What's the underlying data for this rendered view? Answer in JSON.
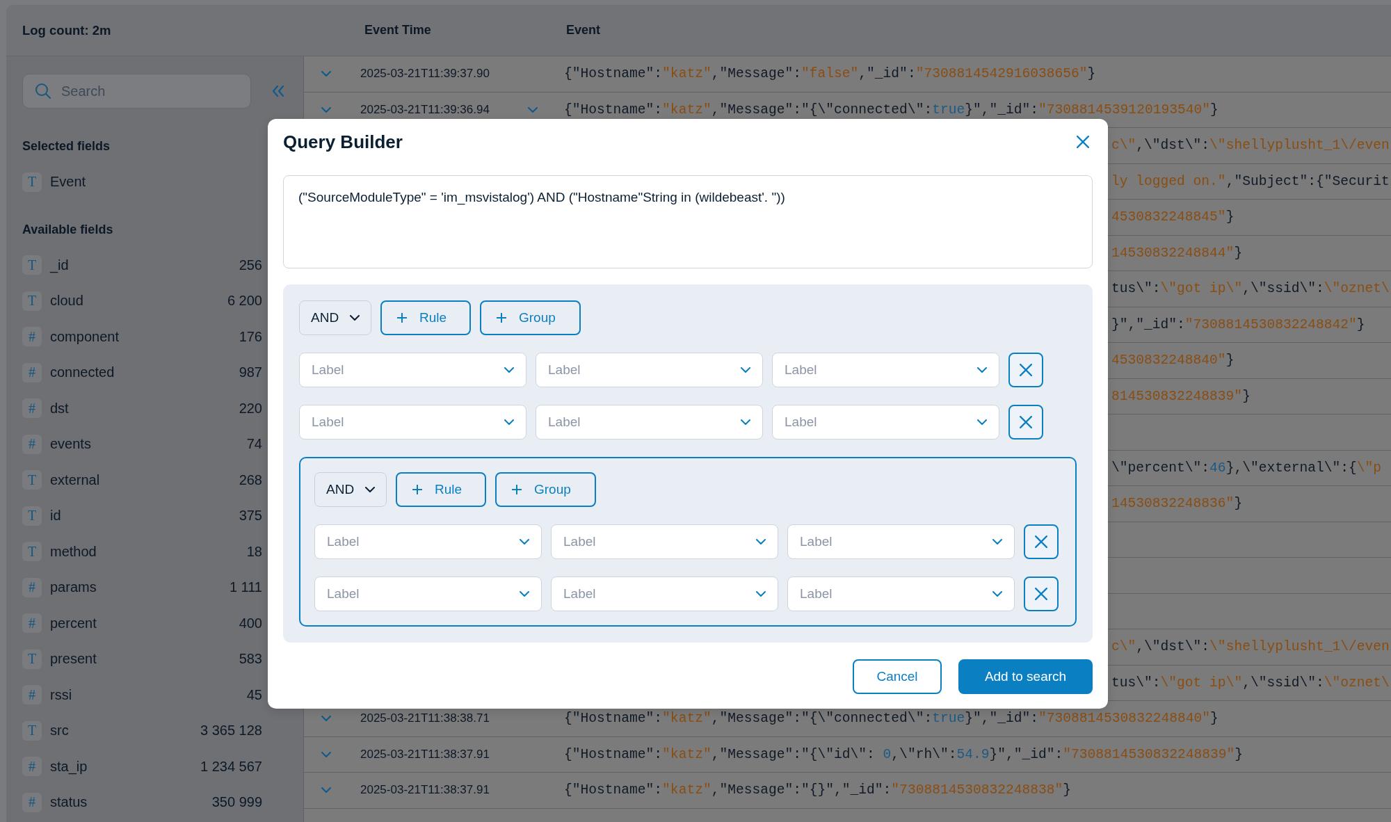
{
  "header": {
    "log_count": "Log count: 2m"
  },
  "sidebar": {
    "search": {
      "placeholder": "Search"
    },
    "selected_title": "Selected fields",
    "selected_fields": [
      {
        "type": "T",
        "name": "Event"
      }
    ],
    "available_title": "Available fields",
    "available_fields": [
      {
        "type": "T",
        "name": "_id",
        "count": "256"
      },
      {
        "type": "T",
        "name": "cloud",
        "count": "6 200"
      },
      {
        "type": "#",
        "name": "component",
        "count": "176"
      },
      {
        "type": "#",
        "name": "connected",
        "count": "987"
      },
      {
        "type": "#",
        "name": "dst",
        "count": "220"
      },
      {
        "type": "#",
        "name": "events",
        "count": "74"
      },
      {
        "type": "T",
        "name": "external",
        "count": "268"
      },
      {
        "type": "T",
        "name": "id",
        "count": "375"
      },
      {
        "type": "T",
        "name": "method",
        "count": "18"
      },
      {
        "type": "#",
        "name": "params",
        "count": "1 111"
      },
      {
        "type": "#",
        "name": "percent",
        "count": "400"
      },
      {
        "type": "T",
        "name": "present",
        "count": "583"
      },
      {
        "type": "#",
        "name": "rssi",
        "count": "45"
      },
      {
        "type": "T",
        "name": "src",
        "count": "3 365 128"
      },
      {
        "type": "#",
        "name": "sta_ip",
        "count": "1 234 567"
      },
      {
        "type": "#",
        "name": "status",
        "count": "350 999"
      }
    ]
  },
  "log_table": {
    "columns": [
      "Event Time",
      "Event"
    ],
    "rows": [
      {
        "time": "2025-03-21T11:39:37.90",
        "hovered": false,
        "event": [
          {
            "kind": "plain",
            "text": "{\"Hostname\":"
          },
          {
            "kind": "string",
            "text": "\"katz\""
          },
          {
            "kind": "plain",
            "text": ",\"Message\":"
          },
          {
            "kind": "string",
            "text": "\"false\""
          },
          {
            "kind": "plain",
            "text": ",\"_id\":"
          },
          {
            "kind": "string",
            "text": "\"7308814542916038656\""
          },
          {
            "kind": "plain",
            "text": "}"
          }
        ]
      },
      {
        "time": "2025-03-21T11:39:36.94",
        "hovered": true,
        "event": [
          {
            "kind": "plain",
            "text": "{\"Hostname\":"
          },
          {
            "kind": "string",
            "text": "\"katz\""
          },
          {
            "kind": "plain",
            "text": ",\"Message\":\"{\\\"connected\\\":"
          },
          {
            "kind": "literal",
            "text": "true"
          },
          {
            "kind": "plain",
            "text": "}\",\"_id\":"
          },
          {
            "kind": "string",
            "text": "\"7308814539120193540\""
          },
          {
            "kind": "plain",
            "text": "}"
          }
        ]
      },
      {
        "event": [
          {
            "kind": "string",
            "text": "c\\\""
          },
          {
            "kind": "plain",
            "text": ",\\\"dst\\\":"
          },
          {
            "kind": "string",
            "text": "\\\"shellyplusht_1\\/even"
          }
        ]
      },
      {
        "event": [
          {
            "kind": "string",
            "text": "ly logged on.\""
          },
          {
            "kind": "plain",
            "text": ",\"Subject\":{\"Securit"
          }
        ]
      },
      {
        "event": [
          {
            "kind": "string",
            "text": "4530832248845\""
          },
          {
            "kind": "plain",
            "text": "}"
          }
        ]
      },
      {
        "event": [
          {
            "kind": "string",
            "text": "14530832248844\""
          },
          {
            "kind": "plain",
            "text": "}"
          }
        ]
      },
      {
        "event": [
          {
            "kind": "plain",
            "text": "tus\\\":"
          },
          {
            "kind": "string",
            "text": "\\\"got ip\\\""
          },
          {
            "kind": "plain",
            "text": ",\\\"ssid\\\":"
          },
          {
            "kind": "string",
            "text": "\\\"oznet\\"
          }
        ]
      },
      {
        "event": [
          {
            "kind": "plain",
            "text": "}\",\"_id\":"
          },
          {
            "kind": "string",
            "text": "\"7308814530832248842\""
          },
          {
            "kind": "plain",
            "text": "}"
          }
        ]
      },
      {
        "event": [
          {
            "kind": "string",
            "text": "4530832248840\""
          },
          {
            "kind": "plain",
            "text": "}"
          }
        ]
      },
      {
        "event": [
          {
            "kind": "string",
            "text": "814530832248839\""
          },
          {
            "kind": "plain",
            "text": "}"
          }
        ]
      },
      {},
      {
        "event": [
          {
            "kind": "plain",
            "text": "\\\"percent\\\":"
          },
          {
            "kind": "literal",
            "text": "46"
          },
          {
            "kind": "plain",
            "text": "},\\\"external\\\":{"
          },
          {
            "kind": "string",
            "text": "\\\"p"
          }
        ]
      },
      {
        "event": [
          {
            "kind": "string",
            "text": "14530832248836\""
          },
          {
            "kind": "plain",
            "text": "}"
          }
        ]
      },
      {},
      {},
      {},
      {
        "event": [
          {
            "kind": "string",
            "text": "c\\\""
          },
          {
            "kind": "plain",
            "text": ",\\\"dst\\\":"
          },
          {
            "kind": "string",
            "text": "\\\"shellyplusht_1\\/even"
          }
        ]
      },
      {
        "event": [
          {
            "kind": "plain",
            "text": "tus\\\":"
          },
          {
            "kind": "string",
            "text": "\\\"got ip\\\""
          },
          {
            "kind": "plain",
            "text": ",\\\"ssid\\\":"
          },
          {
            "kind": "string",
            "text": "\\\"oznet\\"
          }
        ]
      },
      {
        "time": "2025-03-21T11:38:38.71",
        "hovered": false,
        "event": [
          {
            "kind": "plain",
            "text": "{\"Hostname\":"
          },
          {
            "kind": "string",
            "text": "\"katz\""
          },
          {
            "kind": "plain",
            "text": ",\"Message\":\"{\\\"connected\\\":"
          },
          {
            "kind": "literal",
            "text": "true"
          },
          {
            "kind": "plain",
            "text": "}\",\"_id\":"
          },
          {
            "kind": "string",
            "text": "\"7308814530832248840\""
          },
          {
            "kind": "plain",
            "text": "}"
          }
        ]
      },
      {
        "time": "2025-03-21T11:38:37.91",
        "hovered": false,
        "event": [
          {
            "kind": "plain",
            "text": "{\"Hostname\":"
          },
          {
            "kind": "string",
            "text": "\"katz\""
          },
          {
            "kind": "plain",
            "text": ",\"Message\":\"{\\\"id\\\": "
          },
          {
            "kind": "literal",
            "text": "0"
          },
          {
            "kind": "plain",
            "text": ",\\\"rh\\\":"
          },
          {
            "kind": "literal",
            "text": "54.9"
          },
          {
            "kind": "plain",
            "text": "}\",\"_id\":"
          },
          {
            "kind": "string",
            "text": "\"7308814530832248839\""
          },
          {
            "kind": "plain",
            "text": "}"
          }
        ]
      },
      {
        "time": "2025-03-21T11:38:37.91",
        "hovered": false,
        "event": [
          {
            "kind": "plain",
            "text": "{\"Hostname\":"
          },
          {
            "kind": "string",
            "text": "\"katz\""
          },
          {
            "kind": "plain",
            "text": ",\"Message\":\"{}\",\"_id\":"
          },
          {
            "kind": "string",
            "text": "\"7308814530832248838\""
          },
          {
            "kind": "plain",
            "text": "}"
          }
        ]
      },
      {}
    ]
  },
  "query_builder": {
    "title": "Query Builder",
    "query": "(\"SourceModuleType\" = 'im_msvistalog') AND (\"Hostname\"String in (wildebeast'. \"))",
    "root": {
      "combinator": "AND",
      "add_rule": "Rule",
      "add_group": "Group",
      "children": [
        {
          "kind": "rule",
          "fields": [
            {
              "placeholder": "Label"
            },
            {
              "placeholder": "Label"
            },
            {
              "placeholder": "Label"
            }
          ]
        },
        {
          "kind": "rule",
          "fields": [
            {
              "placeholder": "Label"
            },
            {
              "placeholder": "Label"
            },
            {
              "placeholder": "Label"
            }
          ]
        },
        {
          "kind": "group",
          "combinator": "AND",
          "add_rule": "Rule",
          "add_group": "Group",
          "children": [
            {
              "kind": "rule",
              "fields": [
                {
                  "placeholder": "Label"
                },
                {
                  "placeholder": "Label"
                },
                {
                  "placeholder": "Label"
                }
              ]
            },
            {
              "kind": "rule",
              "fields": [
                {
                  "placeholder": "Label"
                },
                {
                  "placeholder": "Label"
                },
                {
                  "placeholder": "Label"
                }
              ]
            }
          ]
        }
      ]
    },
    "buttons": [
      {
        "label": "Cancel",
        "kind": "secondary"
      },
      {
        "label": "Add to search",
        "kind": "primary"
      }
    ]
  }
}
